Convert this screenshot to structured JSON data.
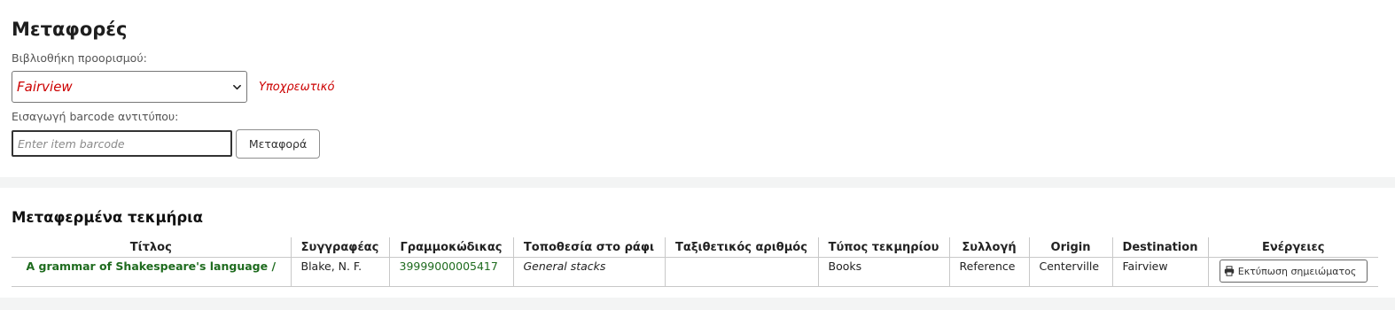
{
  "page": {
    "title": "Μεταφορές"
  },
  "form": {
    "library_label": "Βιβλιοθήκη προορισμού:",
    "library_selected": "Fairview",
    "required_note": "Υποχρεωτικό",
    "barcode_label": "Εισαγωγή barcode αντιτύπου:",
    "barcode_value": "",
    "barcode_placeholder": "Enter item barcode",
    "submit_label": "Μεταφορά"
  },
  "transferred": {
    "section_title": "Μεταφερμένα τεκμήρια",
    "columns": [
      "Τίτλος",
      "Συγγραφέας",
      "Γραμμοκώδικας",
      "Τοποθεσία στο ράφι",
      "Ταξιθετικός αριθμός",
      "Τύπος τεκμηρίου",
      "Συλλογή",
      "Origin",
      "Destination",
      "Ενέργειες"
    ],
    "rows": [
      {
        "title": "A grammar of Shakespeare's language /",
        "author": "Blake, N. F.",
        "barcode": "39999000005417",
        "shelving_location": "General stacks",
        "call_number": "",
        "item_type": "Books",
        "collection": "Reference",
        "origin": "Centerville",
        "destination": "Fairview",
        "action_label": "Εκτύπωση σημειώματος"
      }
    ]
  },
  "colors": {
    "link_green": "#1e6b1e",
    "required_red": "#cc0000",
    "band_gray": "#f3f4f4"
  },
  "icons": {
    "select_arrow": "chevron-down-icon",
    "print": "printer-icon"
  }
}
